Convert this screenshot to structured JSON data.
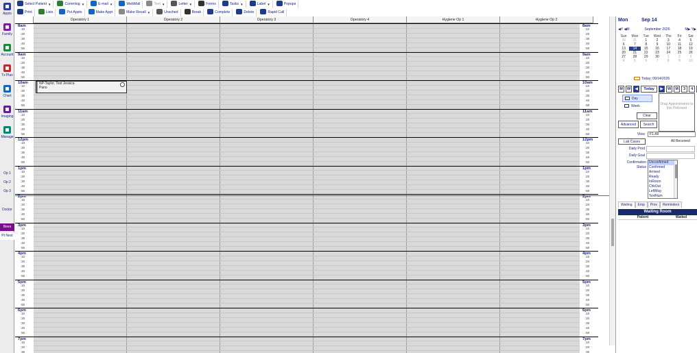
{
  "modules": [
    {
      "label": "Appts",
      "icon": "appointments-calendar-icon"
    },
    {
      "label": "Family",
      "icon": "family-icon"
    },
    {
      "label": "Account",
      "icon": "account-icon"
    },
    {
      "label": "Tx Plan",
      "icon": "treatment-plan-icon"
    },
    {
      "label": "Chart",
      "icon": "chart-icon"
    },
    {
      "label": "Imaging",
      "icon": "imaging-icon"
    },
    {
      "label": "Manage",
      "icon": "manage-icon"
    }
  ],
  "operatory_buttons": [
    "Op 1",
    "Op 2",
    "Op 3"
  ],
  "doctor_label": "Doctor",
  "clinic_buttons": [
    {
      "label": "Bees",
      "color": "#7a0f8c"
    },
    {
      "label": "Pt Next",
      "color": "#ffffff"
    }
  ],
  "toolbar_main": [
    {
      "label": "Select Patient",
      "icon": "select-patient-icon",
      "dropdown": true,
      "disabled": false
    },
    {
      "label": "Commlog",
      "icon": "commlog-icon",
      "dropdown": true,
      "disabled": false
    },
    {
      "label": "E-mail",
      "icon": "email-icon",
      "dropdown": true,
      "disabled": false
    },
    {
      "label": "WebMail",
      "icon": "webmail-icon",
      "dropdown": false,
      "disabled": false
    },
    {
      "label": "Text",
      "icon": "text-message-icon",
      "dropdown": true,
      "disabled": true
    },
    {
      "label": "Letter",
      "icon": "letter-icon",
      "dropdown": true,
      "disabled": false
    },
    {
      "label": "Forms",
      "icon": "forms-icon",
      "dropdown": false,
      "disabled": false
    },
    {
      "label": "Tasks",
      "icon": "tasks-icon",
      "dropdown": true,
      "disabled": false
    },
    {
      "label": "Label",
      "icon": "label-icon",
      "dropdown": true,
      "disabled": false
    },
    {
      "label": "Popups",
      "icon": "popups-icon",
      "dropdown": false,
      "disabled": false
    }
  ],
  "toolbar_appt": [
    {
      "label": "Print",
      "icon": "print-icon",
      "dropdown": false
    },
    {
      "label": "Lists",
      "icon": "lists-icon",
      "dropdown": false
    },
    {
      "label": "Put Appts",
      "icon": "put-appts-icon",
      "dropdown": false
    },
    {
      "label": "Make Appt",
      "icon": "plus-icon",
      "dropdown": false
    },
    {
      "label": "Make Recall",
      "icon": "make-recall-icon",
      "dropdown": true
    },
    {
      "label": "Unsched",
      "icon": "unschedule-icon",
      "dropdown": false
    },
    {
      "label": "Break",
      "icon": "break-icon",
      "dropdown": false
    },
    {
      "label": "Complete",
      "icon": "complete-check-icon",
      "dropdown": false
    },
    {
      "label": "Delete",
      "icon": "delete-x-icon",
      "dropdown": false
    },
    {
      "label": "Rapid Call",
      "icon": "rapid-call-icon",
      "dropdown": false
    }
  ],
  "operatories": [
    "Operatory 1",
    "Operatory 2",
    "Operatory 3",
    "Operatory 4",
    "Hygiene Op 1",
    "Hygiene Op 2"
  ],
  "hours": [
    "8am",
    "9am",
    "10am",
    "11am",
    "12pm",
    "1pm",
    "2pm",
    "3pm",
    "4pm",
    "5pm",
    "6pm",
    "7pm"
  ],
  "minute_labels": [
    ":10",
    ":20",
    ":30",
    ":40",
    ":50"
  ],
  "current_time_fraction": 0.5,
  "appointment": {
    "line1": "NP-Taylor, Test Jessica",
    "line2": "Pano",
    "operatory": 0,
    "start_hour_index": 2,
    "duration_minutes": 30
  },
  "right_panel": {
    "day_name": "Mon",
    "date_label": "Sep 14",
    "calendar": {
      "nav_left_y": "◀Y",
      "nav_left_m": "◀M",
      "month_title": "September 2026",
      "nav_right_m": "M▶",
      "nav_right_y": "Y▶",
      "day_names": [
        "Sun",
        "Mon",
        "Tue",
        "Wed",
        "Thu",
        "Fri",
        "Sat"
      ],
      "weeks": [
        [
          "30",
          "31",
          "1",
          "2",
          "3",
          "4",
          "5"
        ],
        [
          "6",
          "7",
          "8",
          "9",
          "10",
          "11",
          "12"
        ],
        [
          "13",
          "14",
          "15",
          "16",
          "17",
          "18",
          "19"
        ],
        [
          "20",
          "21",
          "22",
          "23",
          "24",
          "25",
          "26"
        ],
        [
          "27",
          "28",
          "29",
          "30",
          "1",
          "2",
          "3"
        ],
        [
          "4",
          "5",
          "6",
          "7",
          "8",
          "9",
          "10"
        ]
      ],
      "selected_day": "14"
    },
    "today_text": "Today: 09/14/2026",
    "nav_buttons": [
      "M",
      "W",
      "◀",
      "Today",
      "▶",
      "W",
      "M",
      "3",
      "4",
      "6"
    ],
    "view_day": "Day",
    "view_week": "Week",
    "clear": "Clear",
    "pinboard_text": "Drag Appointments to this Pinboard",
    "advanced": "Advanced",
    "search": "Search",
    "view_label": "View",
    "view_value": "F1-All",
    "lab_cases": "Lab Cases",
    "all_received": "All Received",
    "daily_prod": "Daily Prod",
    "daily_goal": "Daily Goal",
    "confirmation_label_1": "Confirmation",
    "confirmation_label_2": "Status",
    "confirmation_items": [
      "Unconfirmed",
      "Confirmed",
      "Arrived",
      "Ready",
      "InRoom",
      "ChkOut",
      "LeftMsg",
      "TextNum"
    ],
    "tabs": [
      "Waiting",
      "Emp",
      "Prov",
      "Reminders"
    ],
    "waiting_room_title": "Waiting Room",
    "waiting_cols": [
      "Patient",
      "Waited"
    ]
  }
}
